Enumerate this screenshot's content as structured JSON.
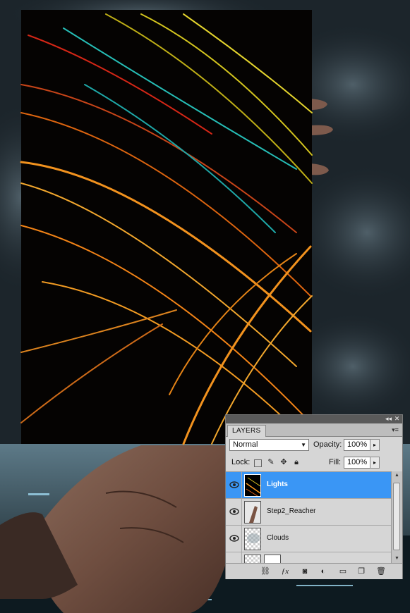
{
  "panel": {
    "tab_label": "LAYERS",
    "collapse_icon": "double-chevron-left-icon",
    "close_icon": "close-icon",
    "menu_icon": "panel-menu-icon"
  },
  "blend": {
    "mode": "Normal",
    "opacity_label": "Opacity:",
    "opacity_value": "100%",
    "lock_label": "Lock:",
    "fill_label": "Fill:",
    "fill_value": "100%"
  },
  "layers": [
    {
      "name": "Lights",
      "selected": true,
      "visible": true,
      "thumb": "lights-thumbnail"
    },
    {
      "name": "Step2_Reacher",
      "selected": false,
      "visible": true,
      "thumb": "reacher-thumbnail"
    },
    {
      "name": "Clouds",
      "selected": false,
      "visible": true,
      "thumb": "clouds-thumbnail"
    }
  ],
  "bottom_icons": [
    "link-icon",
    "fx-icon",
    "mask-icon",
    "adjustment-icon",
    "folder-icon",
    "new-layer-icon",
    "trash-icon"
  ],
  "colors": {
    "selection": "#3a96f5",
    "panel_bg": "#d6d6d6"
  }
}
